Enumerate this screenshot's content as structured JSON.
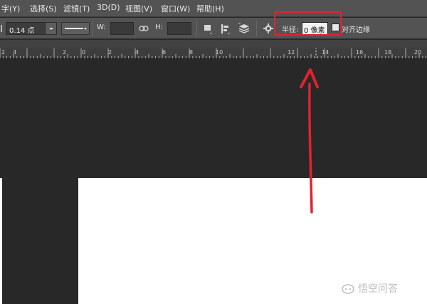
{
  "menu": {
    "items": [
      "字(Y)",
      "选择(S)",
      "滤镜(T)",
      "3D(D)",
      "视图(V)",
      "窗口(W)",
      "帮助(H)"
    ]
  },
  "options": {
    "stroke_width": "0.14 点",
    "w_label": "W:",
    "h_label": "H:",
    "radius_label": "半径:",
    "radius_value": "0 像素",
    "align_edges_label": "对齐边缘"
  },
  "ruler": {
    "ticks": [
      "2",
      "4",
      "2",
      "0",
      "2",
      "4",
      "6",
      "8",
      "10",
      "12",
      "14",
      "16",
      "18",
      "20"
    ]
  },
  "watermark": {
    "text": "悟空问答"
  },
  "colors": {
    "annotation": "#e0232f",
    "panel": "#535353",
    "workspace": "#282828"
  }
}
